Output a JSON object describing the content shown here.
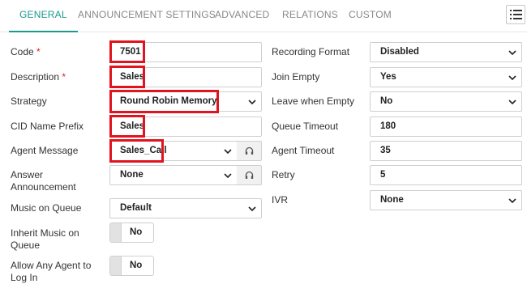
{
  "tabs": [
    {
      "label": "GENERAL"
    },
    {
      "label": "ANNOUNCEMENT SETTINGS"
    },
    {
      "label": "ADVANCED"
    },
    {
      "label": "RELATIONS"
    },
    {
      "label": "CUSTOM"
    }
  ],
  "accent_color": "#1a9a8a",
  "highlight_color": "#e0141e",
  "left": {
    "code": {
      "label": "Code",
      "required": "*",
      "value": "7501"
    },
    "description": {
      "label": "Description",
      "required": "*",
      "value": "Sales"
    },
    "strategy": {
      "label": "Strategy",
      "value": "Round Robin Memory"
    },
    "cid_prefix": {
      "label": "CID Name Prefix",
      "value": "Sales"
    },
    "agent_message": {
      "label": "Agent Message",
      "value": "Sales_Call"
    },
    "answer_announcement": {
      "label_line1": "Answer",
      "label_line2": "Announcement",
      "value": "None"
    },
    "music_on_queue": {
      "label": "Music on Queue",
      "value": "Default"
    },
    "inherit_music": {
      "label_line1": "Inherit Music on",
      "label_line2": "Queue",
      "value": "No"
    },
    "allow_any_agent": {
      "label_line1": "Allow Any Agent to",
      "label_line2": "Log In",
      "value": "No"
    }
  },
  "right": {
    "recording_format": {
      "label": "Recording Format",
      "value": "Disabled"
    },
    "join_empty": {
      "label": "Join Empty",
      "value": "Yes"
    },
    "leave_when_empty": {
      "label": "Leave when Empty",
      "value": "No"
    },
    "queue_timeout": {
      "label": "Queue Timeout",
      "value": "180"
    },
    "agent_timeout": {
      "label": "Agent Timeout",
      "value": "35"
    },
    "retry": {
      "label": "Retry",
      "value": "5"
    },
    "ivr": {
      "label": "IVR",
      "value": "None"
    }
  },
  "icons": {
    "menu": "list-menu-icon",
    "dropdown": "chevron-down-icon",
    "audio": "headphones-icon"
  }
}
